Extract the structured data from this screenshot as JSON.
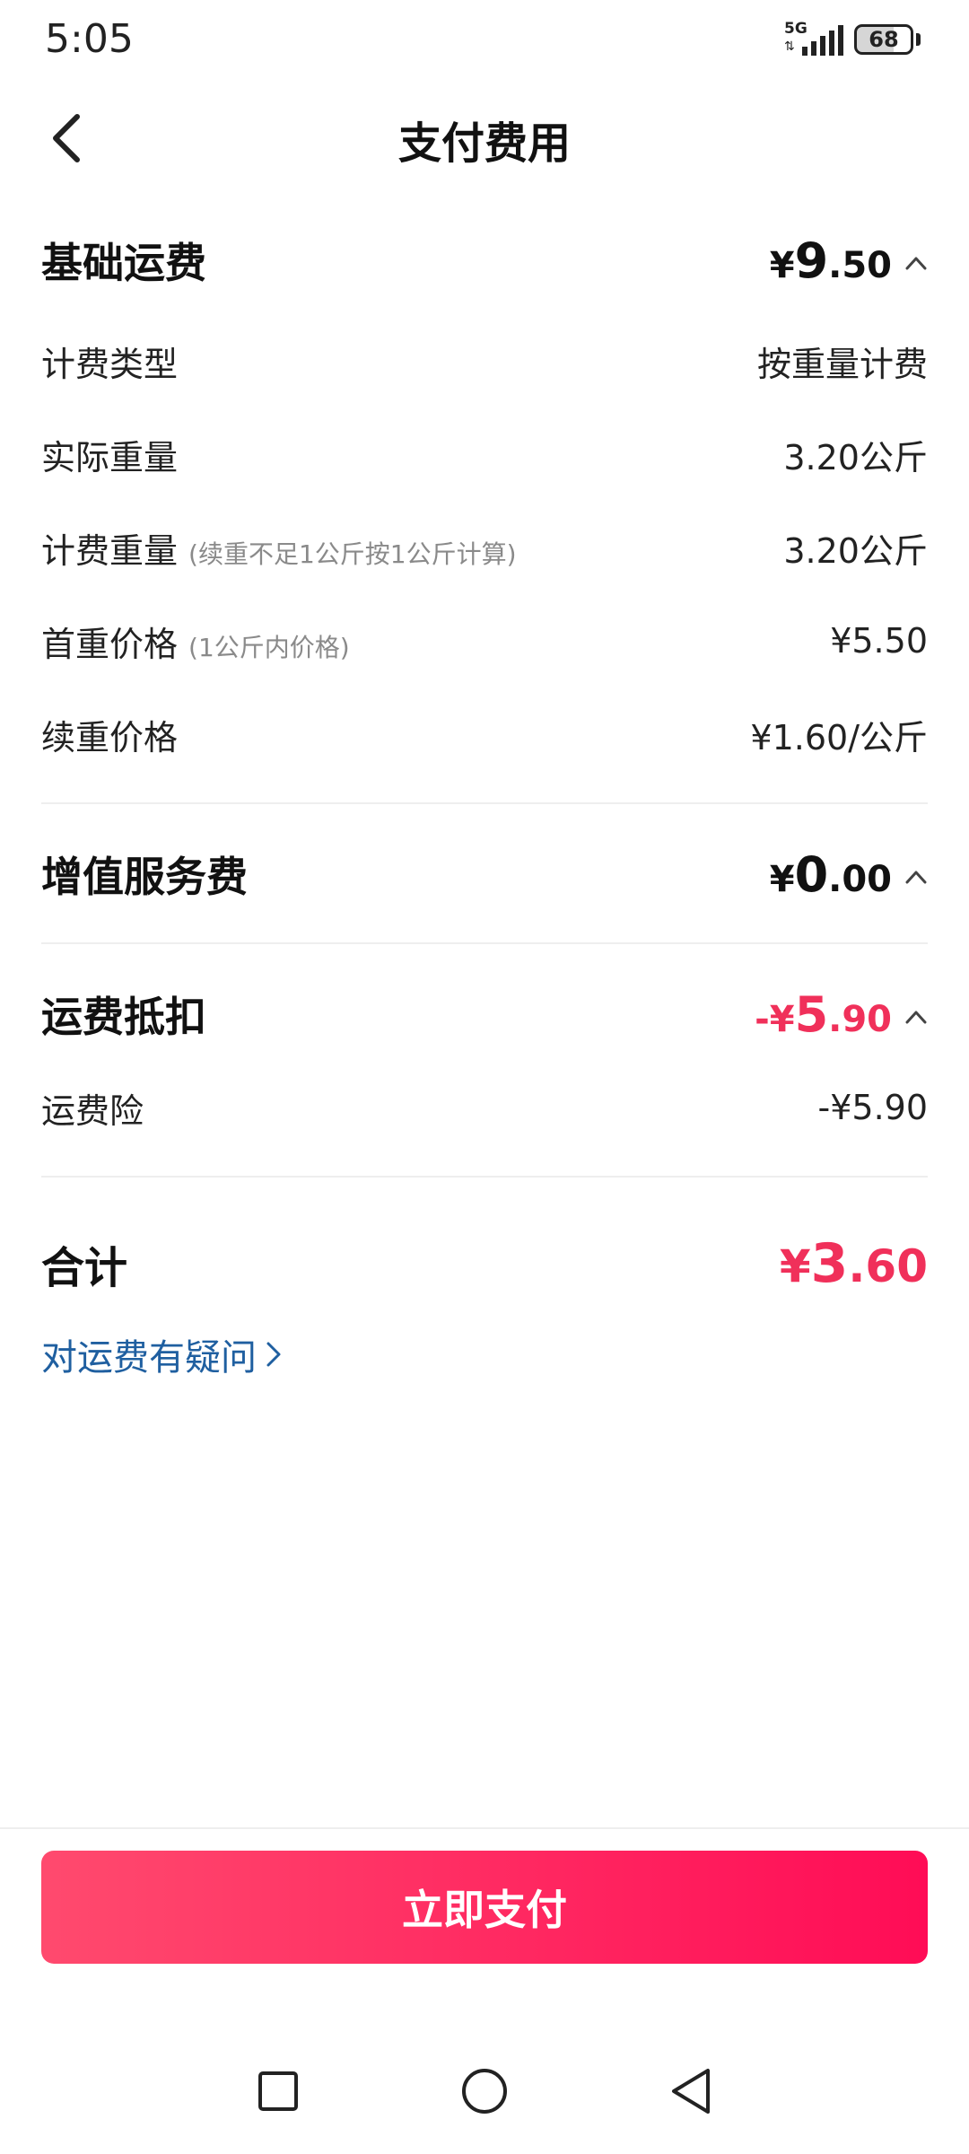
{
  "status_bar": {
    "time": "5:05",
    "network": "5G",
    "battery": "68"
  },
  "header": {
    "title": "支付费用",
    "back_icon": "chevron-left-icon"
  },
  "base_freight": {
    "title": "基础运费",
    "amount": {
      "symbol": "¥",
      "integer": "9",
      "decimal": ".50"
    },
    "rows": [
      {
        "label": "计费类型",
        "note": "",
        "value": "按重量计费"
      },
      {
        "label": "实际重量",
        "note": "",
        "value": "3.20公斤"
      },
      {
        "label": "计费重量",
        "note": "(续重不足1公斤按1公斤计算)",
        "value": "3.20公斤"
      },
      {
        "label": "首重价格",
        "note": "(1公斤内价格)",
        "value": "¥5.50"
      },
      {
        "label": "续重价格",
        "note": "",
        "value": "¥1.60/公斤"
      }
    ]
  },
  "value_added": {
    "title": "增值服务费",
    "amount": {
      "symbol": "¥",
      "integer": "0",
      "decimal": ".00"
    }
  },
  "deduction": {
    "title": "运费抵扣",
    "amount": {
      "symbol": "-¥",
      "integer": "5",
      "decimal": ".90"
    },
    "rows": [
      {
        "label": "运费险",
        "value": "-¥5.90"
      }
    ]
  },
  "total": {
    "label": "合计",
    "amount": {
      "symbol": "¥",
      "integer": "3",
      "decimal": ".60"
    }
  },
  "question_link": "对运费有疑问",
  "pay_button": "立即支付",
  "colors": {
    "accent_red": "#f0305a",
    "link_blue": "#1f5fa0",
    "button_gradient_start": "#ff4a6e",
    "button_gradient_end": "#ff0c56"
  }
}
